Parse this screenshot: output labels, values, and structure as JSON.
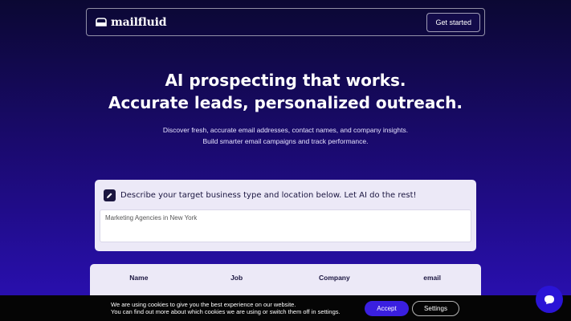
{
  "nav": {
    "brand": "mailfluid",
    "cta_label": "Get started"
  },
  "hero": {
    "title_line1": "AI prospecting that works.",
    "title_line2": "Accurate leads, personalized outreach.",
    "subtitle_line1": "Discover fresh, accurate email addresses, contact names, and company insights.",
    "subtitle_line2": "Build smarter email campaigns and track performance."
  },
  "prompt": {
    "label": "Describe your target business type and location below. Let AI do the rest!",
    "value": "Marketing Agencies in New York"
  },
  "table": {
    "columns": [
      "Name",
      "Job",
      "Company",
      "email"
    ]
  },
  "cookie": {
    "line1": "We are using cookies to give you the best experience on our website.",
    "line2": "You can find out more about which cookies we are using or switch them off in settings.",
    "accept_label": "Accept",
    "settings_label": "Settings"
  },
  "colors": {
    "accent": "#3a1fe0",
    "card": "#ece9f7",
    "dark": "#1b1640"
  }
}
